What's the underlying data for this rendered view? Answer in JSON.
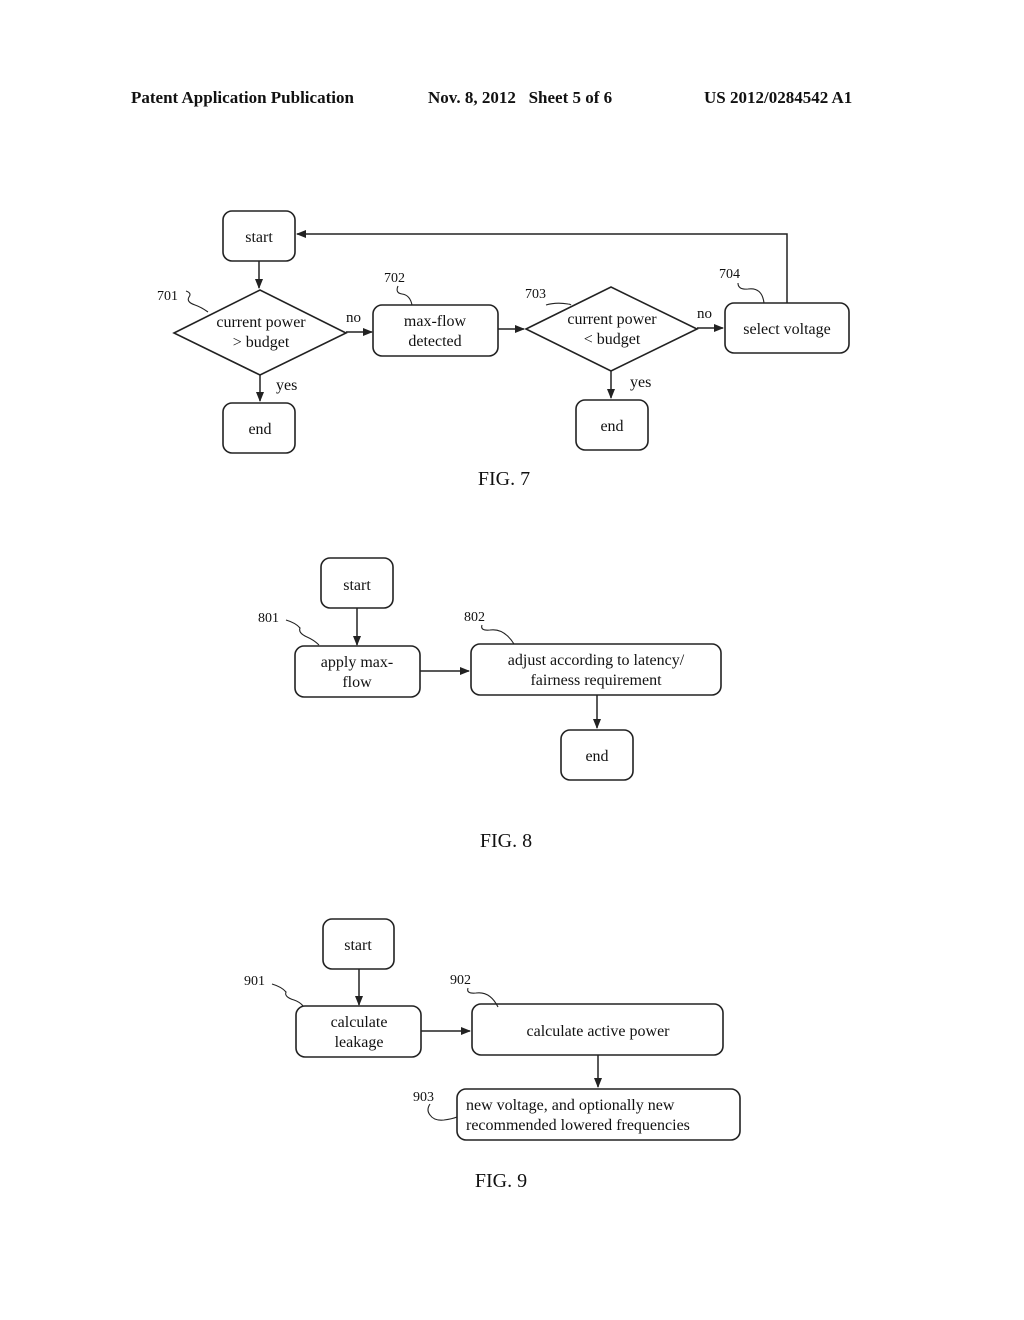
{
  "header": {
    "publication": "Patent Application Publication",
    "date_sheet": "Nov. 8, 2012   Sheet 5 of 6",
    "number": "US 2012/0284542 A1"
  },
  "fig7": {
    "caption": "FIG. 7",
    "start": "start",
    "d701": {
      "ref": "701",
      "line1": "current power",
      "line2": "> budget"
    },
    "b702": {
      "ref": "702",
      "line1": "max-flow",
      "line2": "detected"
    },
    "d703": {
      "ref": "703",
      "line1": "current power",
      "line2": "< budget"
    },
    "b704": {
      "ref": "704",
      "label": "select voltage"
    },
    "no1": "no",
    "yes1": "yes",
    "no2": "no",
    "yes2": "yes",
    "end1": "end",
    "end2": "end"
  },
  "fig8": {
    "caption": "FIG. 8",
    "start": "start",
    "b801": {
      "ref": "801",
      "line1": "apply max-",
      "line2": "flow"
    },
    "b802": {
      "ref": "802",
      "line1": "adjust according to latency/",
      "line2": "fairness requirement"
    },
    "end": "end"
  },
  "fig9": {
    "caption": "FIG. 9",
    "start": "start",
    "b901": {
      "ref": "901",
      "line1": "calculate",
      "line2": "leakage"
    },
    "b902": {
      "ref": "902",
      "label": "calculate active power"
    },
    "b903": {
      "ref": "903",
      "line1": "new voltage, and optionally new",
      "line2": "recommended lowered frequencies"
    }
  }
}
